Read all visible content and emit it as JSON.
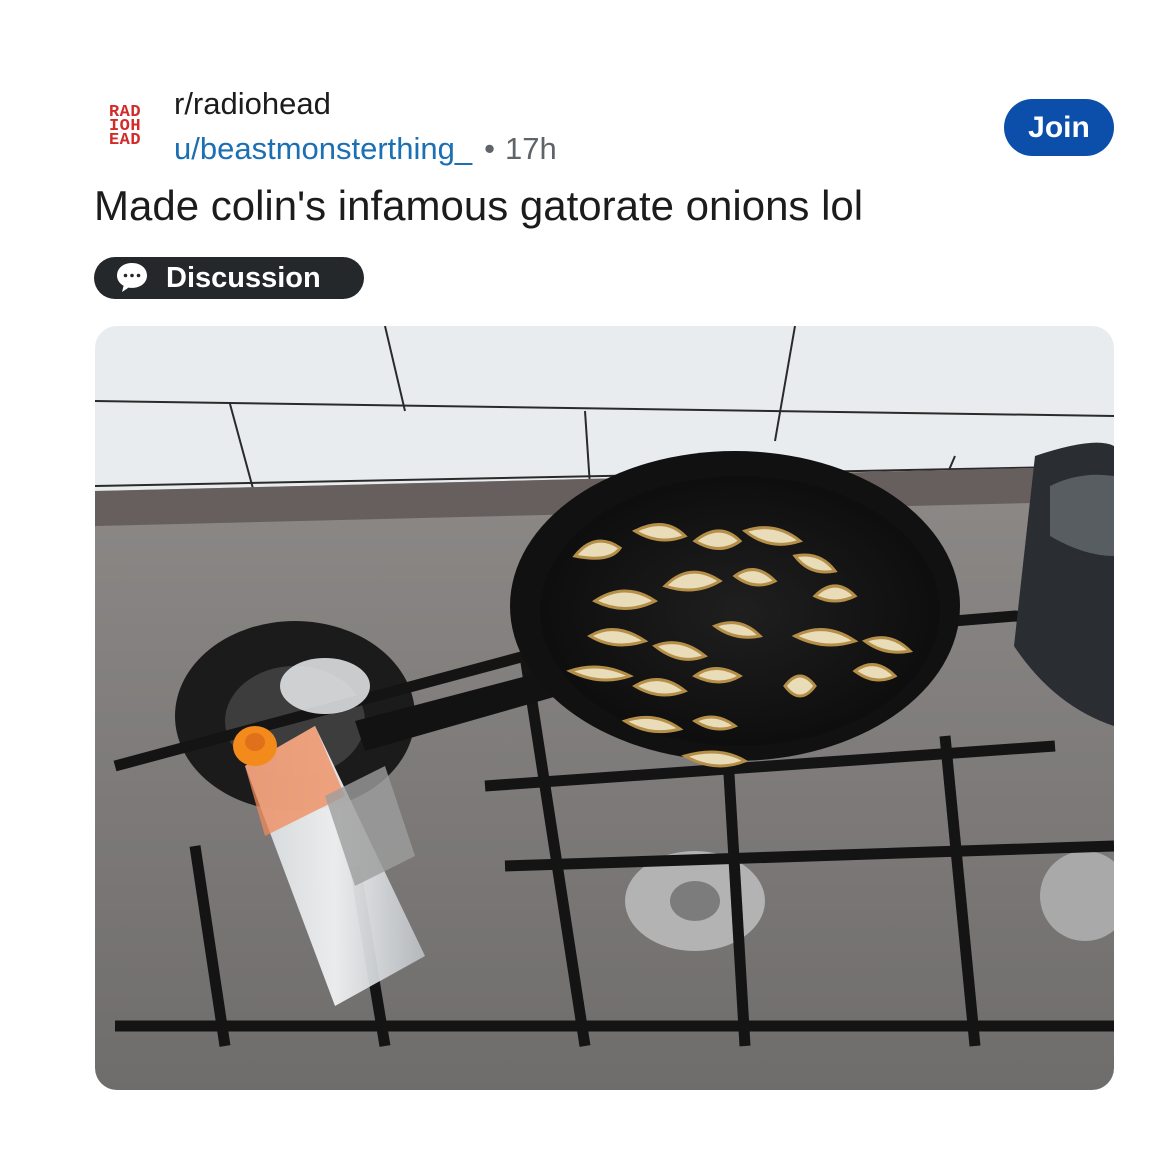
{
  "community": {
    "avatar_lines": [
      "RAD",
      "IOH",
      "EAD"
    ],
    "name": "r/radiohead"
  },
  "author": {
    "username": "u/beastmonsterthing_",
    "separator": "•",
    "age": "17h"
  },
  "join_label": "Join",
  "post": {
    "title": "Made colin's infamous gatorate onions lol",
    "flair": {
      "icon": "speech-bubble-icon",
      "label": "Discussion"
    }
  },
  "media": {
    "type": "photo",
    "subject": "frying-pan-with-onions-on-gas-stove"
  },
  "colors": {
    "join_bg": "#0b4fab",
    "username": "#1b6fb3",
    "flair_bg": "#24282b",
    "avatar": "#d32a2a"
  }
}
